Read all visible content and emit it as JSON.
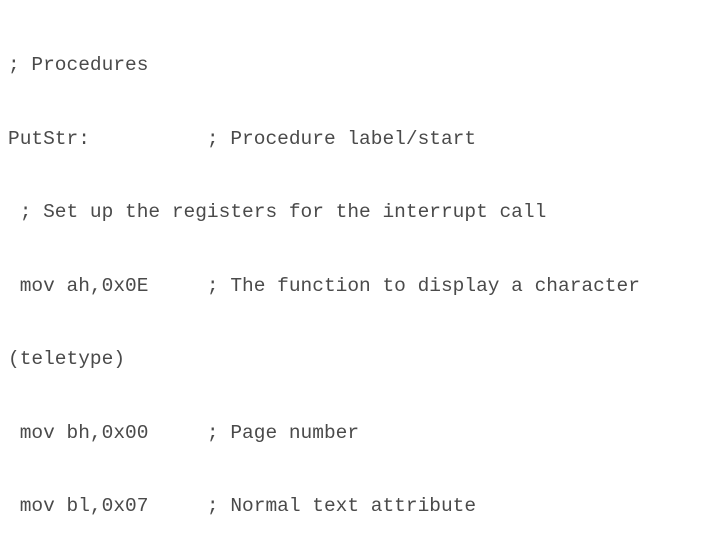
{
  "slide": {
    "code_lines": [
      "; Procedures",
      "PutStr:          ; Procedure label/start",
      " ; Set up the registers for the interrupt call",
      " mov ah,0x0E     ; The function to display a character",
      "(teletype)",
      " mov bh,0x00     ; Page number",
      " mov bl,0x07     ; Normal text attribute"
    ]
  }
}
